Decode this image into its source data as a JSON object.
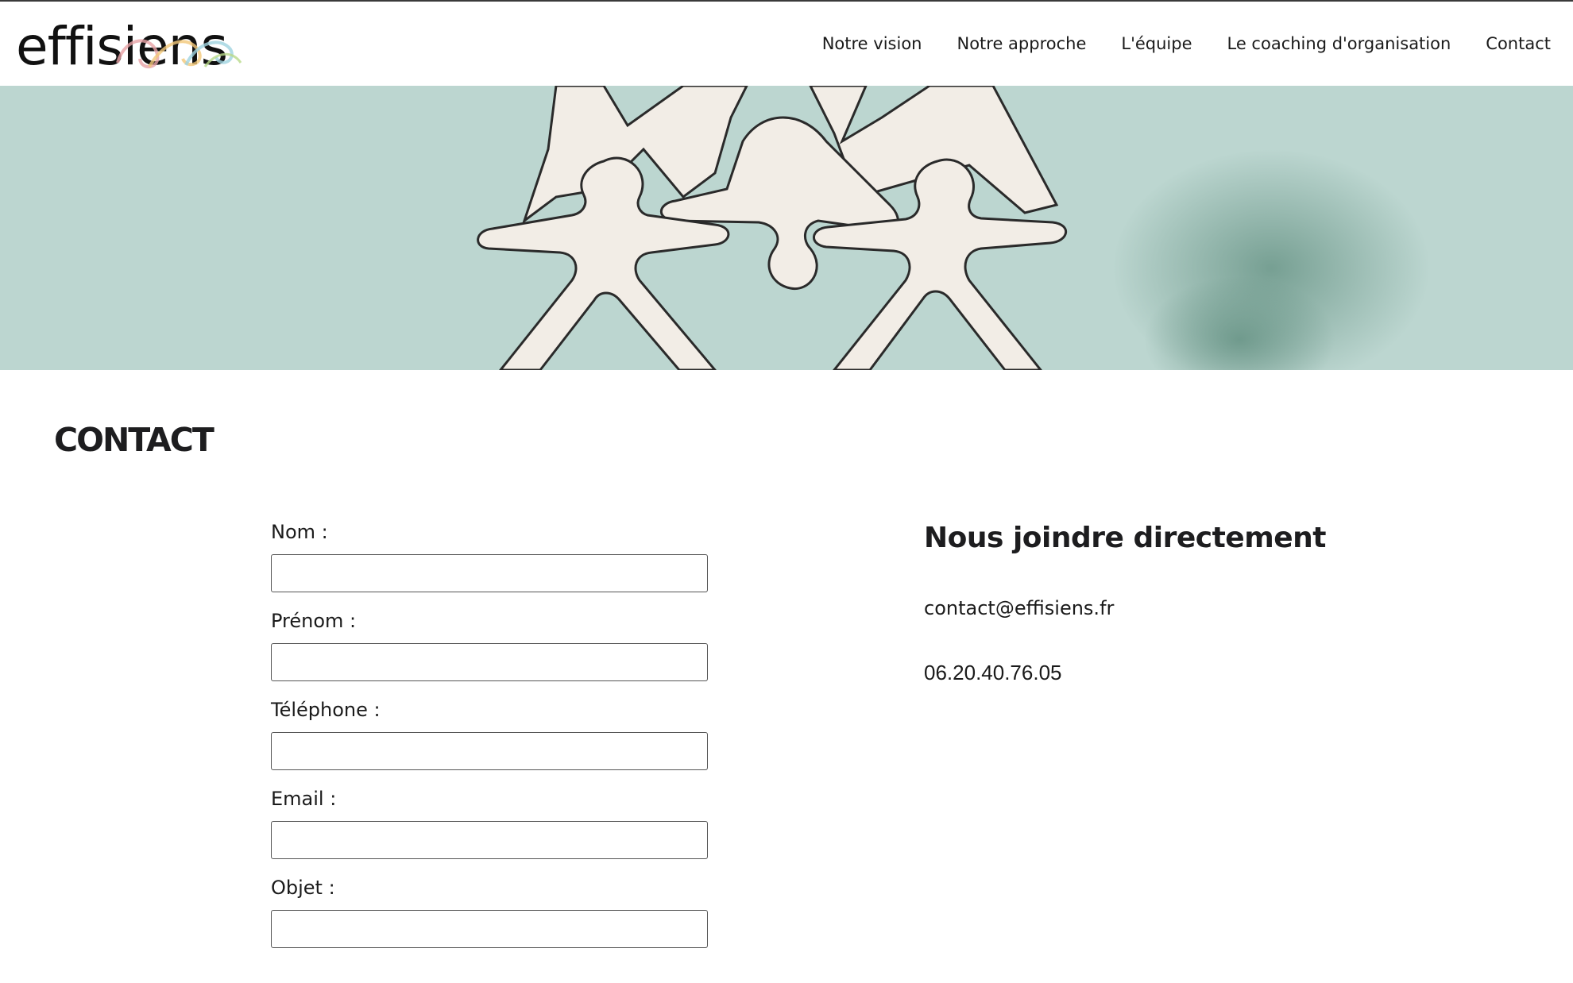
{
  "header": {
    "logo_text": "effisiens",
    "logo_icon": "swirl-logo-icon",
    "nav": [
      {
        "label": "Notre vision"
      },
      {
        "label": "Notre approche"
      },
      {
        "label": "L'équipe"
      },
      {
        "label": "Le coaching d'organisation"
      },
      {
        "label": "Contact"
      }
    ]
  },
  "hero": {
    "image": "wooden-puzzle-people-figures",
    "background_color": "#bcd6d0"
  },
  "main": {
    "title": "CONTACT",
    "form": {
      "fields": [
        {
          "label": "Nom :",
          "value": "",
          "placeholder": ""
        },
        {
          "label": "Prénom :",
          "value": "",
          "placeholder": ""
        },
        {
          "label": "Téléphone :",
          "value": "",
          "placeholder": ""
        },
        {
          "label": "Email :",
          "value": "",
          "placeholder": ""
        },
        {
          "label": "Objet :",
          "value": "",
          "placeholder": ""
        }
      ]
    },
    "contact": {
      "heading": "Nous joindre directement",
      "email": "contact@effisiens.fr",
      "phone": "06.20.40.76.05"
    }
  },
  "colors": {
    "text": "#1d1d1f",
    "hero_bg": "#bcd6d0",
    "figure": "#f2ede6"
  }
}
